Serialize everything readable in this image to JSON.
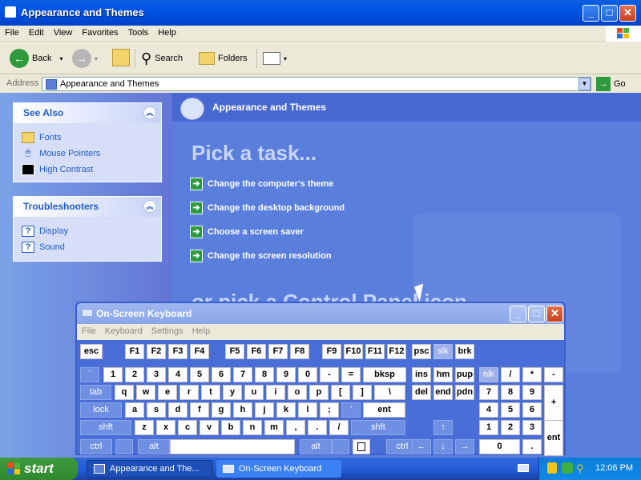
{
  "window": {
    "title": "Appearance and Themes"
  },
  "menu": [
    "File",
    "Edit",
    "View",
    "Favorites",
    "Tools",
    "Help"
  ],
  "toolbar": {
    "back_label": "Back",
    "search_label": "Search",
    "folders_label": "Folders"
  },
  "address": {
    "label": "Address",
    "value": "Appearance and Themes",
    "go_label": "Go"
  },
  "see_also": {
    "title": "See Also",
    "items": [
      "Fonts",
      "Mouse Pointers",
      "High Contrast"
    ]
  },
  "troubleshooters": {
    "title": "Troubleshooters",
    "items": [
      "Display",
      "Sound"
    ]
  },
  "content": {
    "header": "Appearance and Themes",
    "pick_task": "Pick a task...",
    "tasks": [
      "Change the computer's theme",
      "Change the desktop background",
      "Choose a screen saver",
      "Change the screen resolution"
    ],
    "pick_icon": "or pick a Control Panel icon"
  },
  "osk": {
    "title": "On-Screen Keyboard",
    "menu": [
      "File",
      "Keyboard",
      "Settings",
      "Help"
    ],
    "rows": {
      "fn": [
        "esc",
        "F1",
        "F2",
        "F3",
        "F4",
        "F5",
        "F6",
        "F7",
        "F8",
        "F9",
        "F10",
        "F11",
        "F12",
        "psc",
        "slk",
        "brk"
      ],
      "num": [
        "`",
        "1",
        "2",
        "3",
        "4",
        "5",
        "6",
        "7",
        "8",
        "9",
        "0",
        "-",
        "=",
        "bksp",
        "ins",
        "hm",
        "pup",
        "nlk",
        "/",
        "*",
        "-"
      ],
      "q": [
        "tab",
        "q",
        "w",
        "e",
        "r",
        "t",
        "y",
        "u",
        "i",
        "o",
        "p",
        "[",
        "]",
        "\\",
        "del",
        "end",
        "pdn",
        "7",
        "8",
        "9",
        "+"
      ],
      "a": [
        "lock",
        "a",
        "s",
        "d",
        "f",
        "g",
        "h",
        "j",
        "k",
        "l",
        ";",
        "'",
        "ent",
        "4",
        "5",
        "6"
      ],
      "z": [
        "shft",
        "z",
        "x",
        "c",
        "v",
        "b",
        "n",
        "m",
        ",",
        ".",
        "/",
        "shft",
        "↑",
        "1",
        "2",
        "3",
        "ent"
      ],
      "bottom": [
        "ctrl",
        "alt",
        "alt",
        "ctrl",
        "←",
        "↓",
        "→",
        "0",
        "."
      ]
    }
  },
  "taskbar": {
    "start": "start",
    "tasks": [
      "Appearance and The...",
      "On-Screen Keyboard"
    ],
    "clock": "12:06 PM"
  }
}
